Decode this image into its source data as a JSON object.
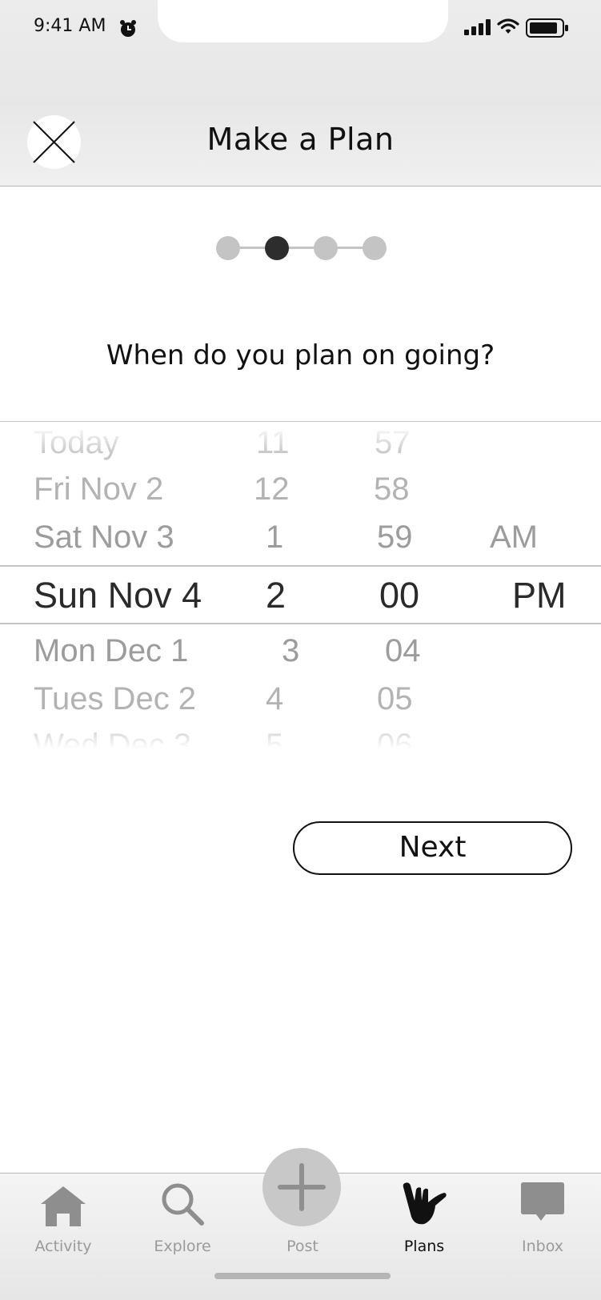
{
  "status_bar": {
    "time": "9:41 AM"
  },
  "header": {
    "title": "Make a Plan"
  },
  "progress": {
    "steps": 4,
    "current_step": 2
  },
  "question": "When do you plan on going?",
  "picker": {
    "rows": [
      {
        "date": "Today",
        "hour": "11",
        "minute": "57",
        "period": ""
      },
      {
        "date": "Fri Nov 2",
        "hour": "12",
        "minute": "58",
        "period": ""
      },
      {
        "date": "Sat Nov 3",
        "hour": "1",
        "minute": "59",
        "period": "AM"
      },
      {
        "date": "Sun Nov 4",
        "hour": "2",
        "minute": "00",
        "period": "PM"
      },
      {
        "date": "Mon Dec 1",
        "hour": "3",
        "minute": "04",
        "period": ""
      },
      {
        "date": "Tues Dec 2",
        "hour": "4",
        "minute": "05",
        "period": ""
      },
      {
        "date": "Wed Dec 3",
        "hour": "5",
        "minute": "06",
        "period": ""
      }
    ],
    "selected_index": 3
  },
  "next_button": {
    "label": "Next"
  },
  "tab_bar": {
    "tabs": [
      {
        "label": "Activity",
        "icon": "home-icon"
      },
      {
        "label": "Explore",
        "icon": "search-icon"
      },
      {
        "label": "Post",
        "icon": "plus-icon"
      },
      {
        "label": "Plans",
        "icon": "shaka-hand-icon",
        "active": true
      },
      {
        "label": "Inbox",
        "icon": "chat-bubble-icon"
      }
    ]
  }
}
